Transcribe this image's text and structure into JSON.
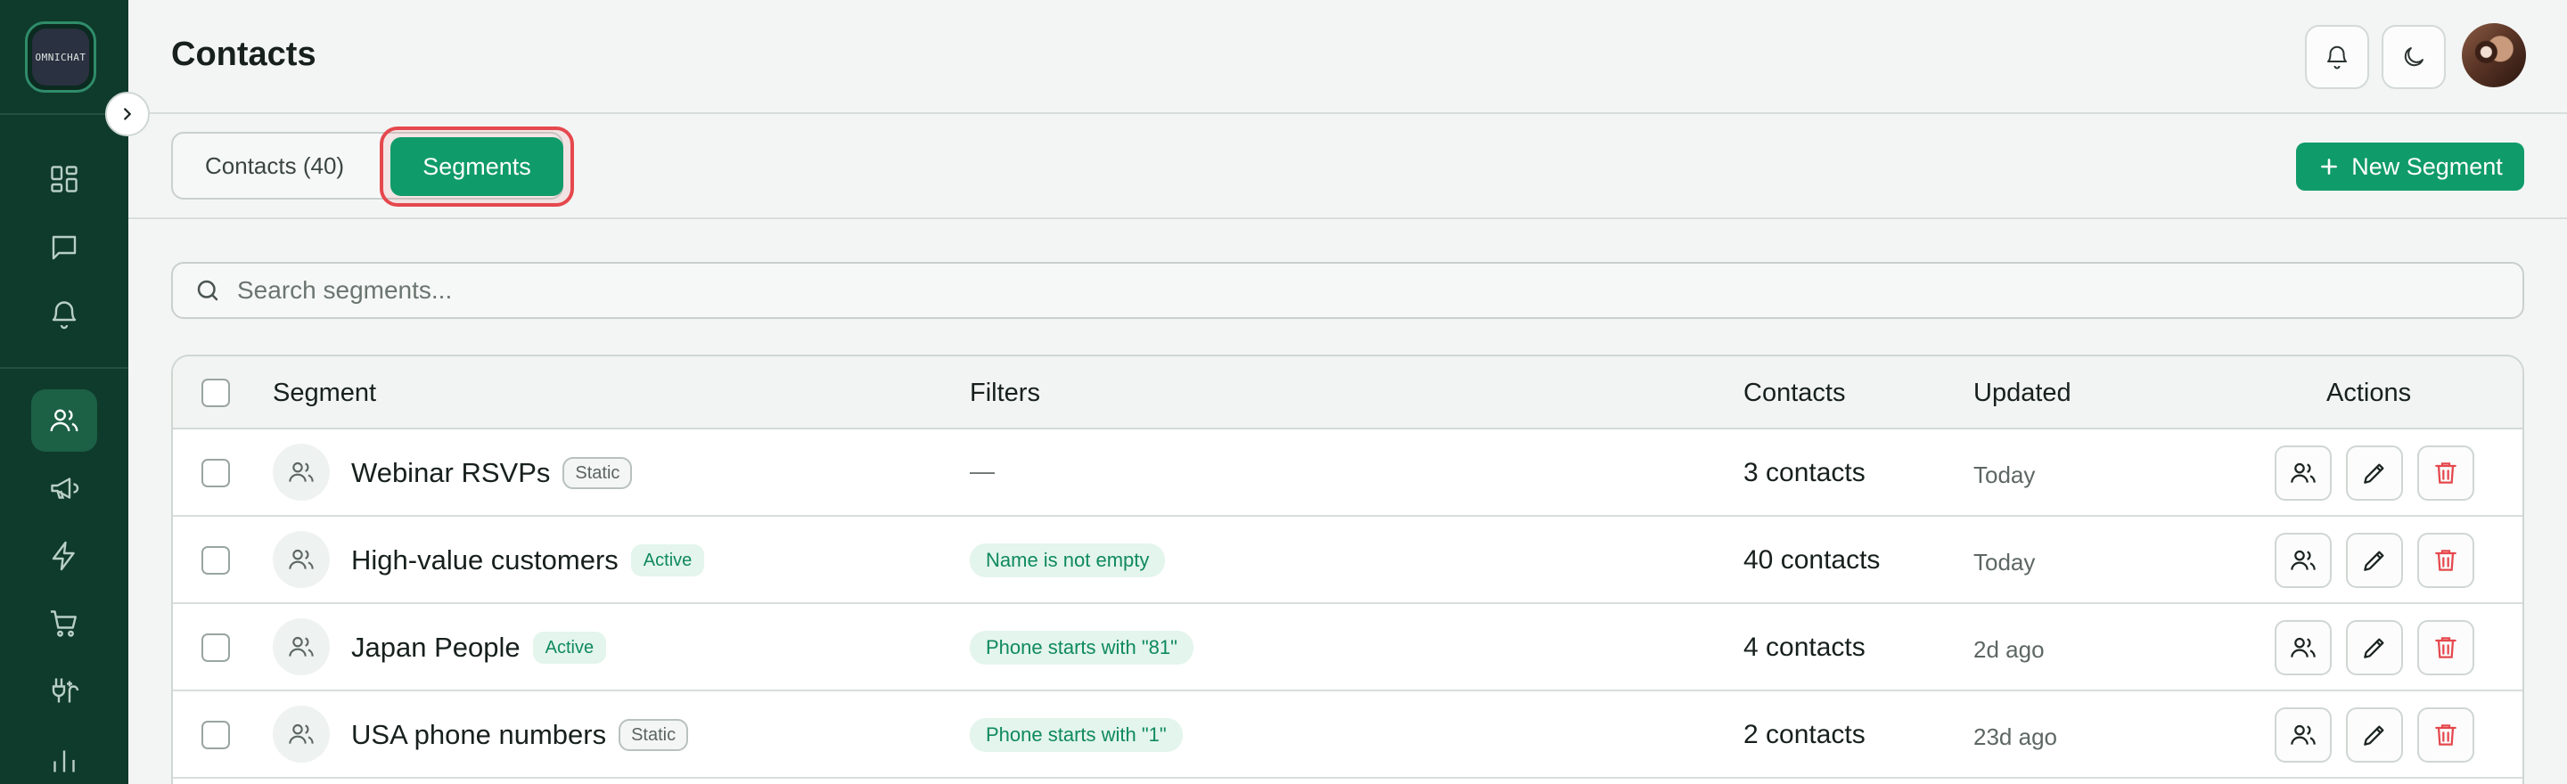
{
  "app": {
    "logo_text": "OMNICHAT",
    "page_title": "Contacts"
  },
  "header": {
    "notifications_icon": "bell-icon",
    "theme_icon": "moon-icon"
  },
  "sidebar": {
    "items": [
      {
        "name": "dashboard",
        "icon": "grid-icon",
        "active": false
      },
      {
        "name": "inbox",
        "icon": "chat-icon",
        "active": false
      },
      {
        "name": "notifications",
        "icon": "bell-icon",
        "active": false
      },
      {
        "name": "contacts",
        "icon": "users-icon",
        "active": true
      },
      {
        "name": "campaigns",
        "icon": "megaphone-icon",
        "active": false
      },
      {
        "name": "automations",
        "icon": "lightning-icon",
        "active": false
      },
      {
        "name": "commerce",
        "icon": "cart-icon",
        "active": false
      },
      {
        "name": "integrations",
        "icon": "plug-icon",
        "active": false
      },
      {
        "name": "analytics",
        "icon": "bar-chart-icon",
        "active": false
      }
    ]
  },
  "tabs": {
    "contacts_label": "Contacts (40)",
    "segments_label": "Segments",
    "active": "segments"
  },
  "actions": {
    "new_segment_label": "New Segment"
  },
  "search": {
    "placeholder": "Search segments...",
    "value": ""
  },
  "table": {
    "headers": {
      "segment": "Segment",
      "filters": "Filters",
      "contacts": "Contacts",
      "updated": "Updated",
      "actions": "Actions"
    },
    "rows": [
      {
        "name": "Webinar RSVPs",
        "type": "Static",
        "filter": "—",
        "contacts": "3 contacts",
        "updated": "Today"
      },
      {
        "name": "High-value customers",
        "type": "Active",
        "filter": "Name is not empty",
        "contacts": "40 contacts",
        "updated": "Today"
      },
      {
        "name": "Japan People",
        "type": "Active",
        "filter": "Phone starts with \"81\"",
        "contacts": "4 contacts",
        "updated": "2d ago"
      },
      {
        "name": "USA phone numbers",
        "type": "Static",
        "filter": "Phone starts with \"1\"",
        "contacts": "2 contacts",
        "updated": "23d ago"
      }
    ]
  },
  "colors": {
    "sidebar_bg": "#0f3b2c",
    "accent": "#109b6a",
    "highlight_ring": "#e5484d",
    "danger": "#e5484d"
  }
}
